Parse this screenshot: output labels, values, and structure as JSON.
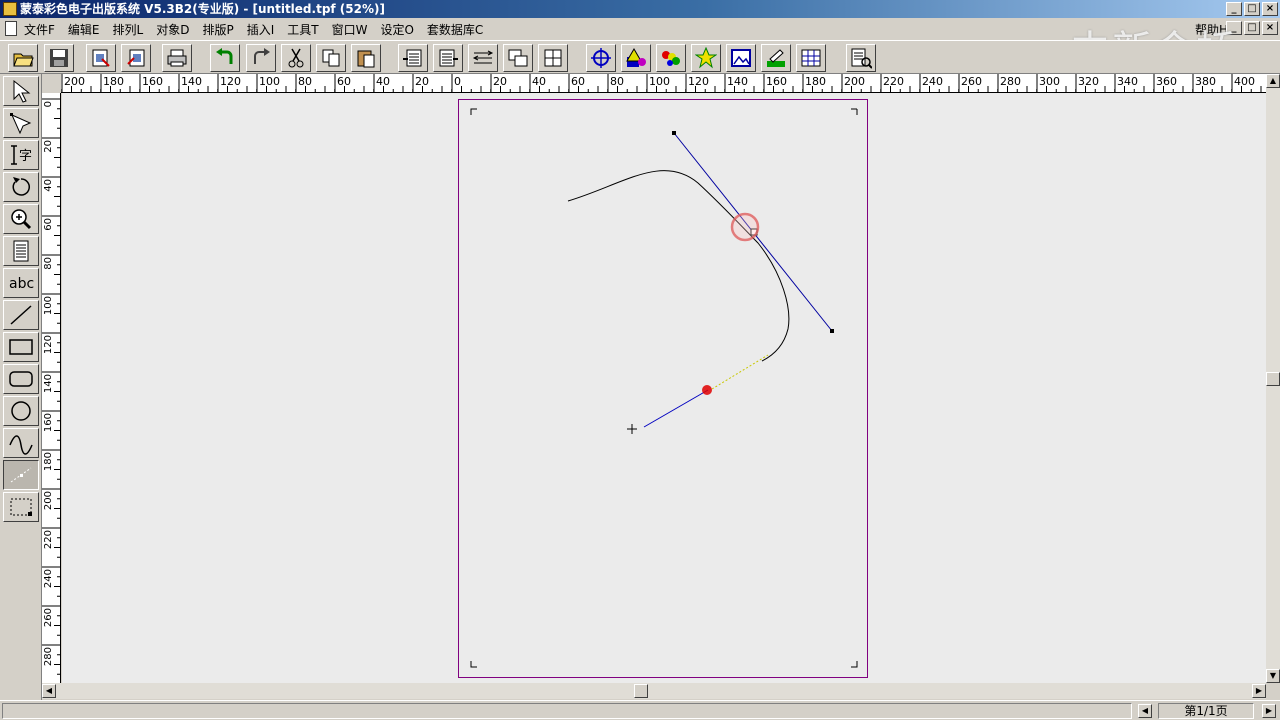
{
  "window": {
    "title": "蒙泰彩色电子出版系统 V5.3B2(专业版) - [untitled.tpf (52%)]"
  },
  "menu": {
    "items": [
      "文件F",
      "编辑E",
      "排列L",
      "对象D",
      "排版P",
      "插入I",
      "工具T",
      "窗口W",
      "设定O",
      "套数据库C"
    ],
    "help": "帮助H"
  },
  "watermark": "中新金桥",
  "toolbar": {
    "icons": [
      "open-icon",
      "save-icon",
      "import-icon",
      "export-icon",
      "print-icon",
      "undo-icon",
      "redo-icon",
      "cut-icon",
      "copy-icon",
      "paste-icon",
      "text-flow-left-icon",
      "text-flow-right-icon",
      "text-wrap-icon",
      "layer-icon",
      "align-icon",
      "position-icon",
      "shape-color-icon",
      "color-palette-icon",
      "star-icon",
      "image-icon",
      "fill-icon",
      "table-icon",
      "page-view-icon"
    ]
  },
  "tools": [
    "pointer-icon",
    "node-select-icon",
    "text-tool-icon",
    "rotate-icon",
    "zoom-icon",
    "text-block-icon",
    "abc-text-icon",
    "line-tool-icon",
    "rectangle-tool-icon",
    "rounded-rect-tool-icon",
    "ellipse-tool-icon",
    "curve-tool-icon",
    "bezier-tool-icon",
    "frame-tool-icon"
  ],
  "rulers": {
    "horizontal": [
      "200",
      "180",
      "160",
      "140",
      "120",
      "100",
      "80",
      "60",
      "40",
      "20",
      "0",
      "20",
      "40",
      "60",
      "80",
      "100",
      "120",
      "140",
      "160",
      "180",
      "200",
      "220",
      "240",
      "260",
      "280",
      "300",
      "320",
      "340",
      "360",
      "380",
      "400"
    ],
    "vertical": [
      "0",
      "20",
      "40",
      "60",
      "80",
      "100",
      "120",
      "140",
      "160",
      "180",
      "200",
      "220",
      "240",
      "260",
      "280"
    ]
  },
  "status": {
    "page": "第1/1页"
  },
  "colors": {
    "titlebar": "#0a246a",
    "page_border": "#800080",
    "bezier_handle": "#0000a0",
    "cursor_highlight": "#e05050"
  }
}
